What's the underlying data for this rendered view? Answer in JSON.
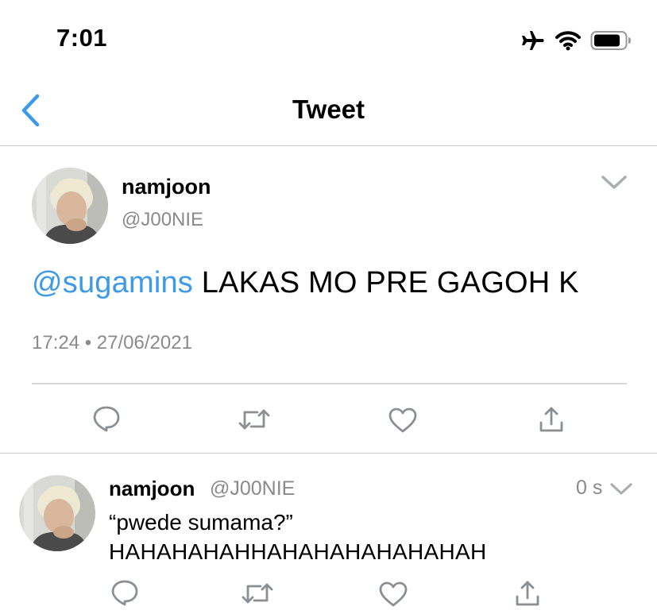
{
  "status_bar": {
    "time": "7:01",
    "icons": [
      "airplane-icon",
      "wifi-icon",
      "battery-icon"
    ]
  },
  "nav": {
    "back_icon": "chevron-left-icon",
    "title": "Tweet"
  },
  "main_tweet": {
    "display_name": "namjoon",
    "handle": "@J00NIE",
    "mention": "@sugamins",
    "text": "LAKAS MO PRE GAGOH K",
    "timestamp": "17:24 • 27/06/2021",
    "actions": [
      "reply-icon",
      "retweet-icon",
      "like-icon",
      "share-icon"
    ]
  },
  "reply": {
    "display_name": "namjoon",
    "handle": "@J00NIE",
    "time_ago": "0 s",
    "line1": "“pwede sumama?”",
    "line2": "HAHAHAHAHHAHAHAHAHAHAHAH",
    "actions": [
      "reply-icon",
      "retweet-icon",
      "like-icon",
      "share-icon"
    ]
  },
  "colors": {
    "accent_blue": "#3d9ae8",
    "secondary_text": "#8a8a8a",
    "icon_gray": "#8a8f94",
    "divider": "#c8c8c8"
  }
}
